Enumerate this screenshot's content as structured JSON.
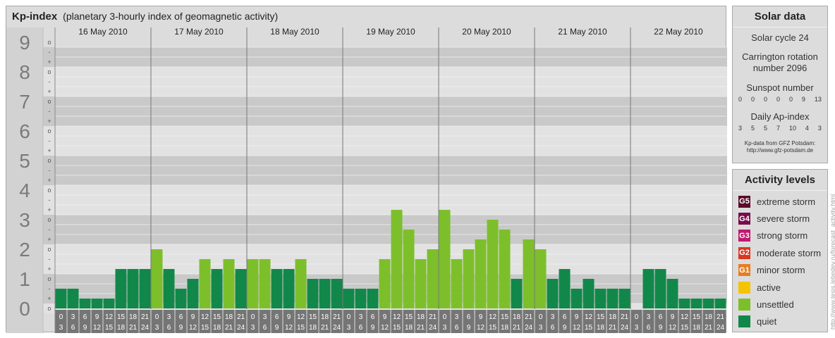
{
  "header": {
    "title": "Kp-index",
    "subtitle": "(planetary 3-hourly index of geomagnetic activity)"
  },
  "chart_data": {
    "type": "bar",
    "title": "Kp-index",
    "subtitle": "(planetary 3-hourly index of geomagnetic activity)",
    "y_ticks": [
      "0",
      "1",
      "2",
      "3",
      "4",
      "5",
      "6",
      "7",
      "8",
      "9"
    ],
    "y_subticks": [
      "o",
      "+",
      "-"
    ],
    "ylim": [
      0,
      9
    ],
    "x_dates": [
      "16 May 2010",
      "17 May 2010",
      "18 May 2010",
      "19 May 2010",
      "20 May 2010",
      "21 May 2010",
      "22 May 2010"
    ],
    "x_time_start": [
      "0",
      "3",
      "6",
      "9",
      "12",
      "15",
      "18",
      "21"
    ],
    "x_time_end": [
      "3",
      "6",
      "9",
      "12",
      "15",
      "18",
      "21",
      "24"
    ],
    "values": [
      [
        0.667,
        0.667,
        0.333,
        0.333,
        0.333,
        1.333,
        1.333,
        1.333
      ],
      [
        2.0,
        1.333,
        0.667,
        1.0,
        1.667,
        1.333,
        1.667,
        1.333
      ],
      [
        1.667,
        1.667,
        1.333,
        1.333,
        1.667,
        1.0,
        1.0,
        1.0
      ],
      [
        0.667,
        0.667,
        0.667,
        1.667,
        3.333,
        2.667,
        1.667,
        2.0
      ],
      [
        3.333,
        1.667,
        2.0,
        2.333,
        3.0,
        2.667,
        1.0,
        2.333
      ],
      [
        2.0,
        1.0,
        1.333,
        0.667,
        1.0,
        0.667,
        0.667,
        0.667
      ],
      [
        0.0,
        1.333,
        1.333,
        1.0,
        0.333,
        0.333,
        0.333,
        0.333
      ]
    ],
    "grid": true,
    "legend": "right"
  },
  "solar": {
    "title": "Solar data",
    "cycle": "Solar cycle 24",
    "carrington_line1": "Carrington rotation",
    "carrington_line2": "number 2096",
    "sunspot_label": "Sunspot number",
    "sunspot_values": [
      "0",
      "0",
      "0",
      "0",
      "0",
      "9",
      "13"
    ],
    "ap_label": "Daily Ap-index",
    "ap_values": [
      "3",
      "5",
      "5",
      "7",
      "10",
      "4",
      "3"
    ],
    "credit_line1": "Kp-data from GFZ Potsdam:",
    "credit_line2": "http://www.gfz-potsdam.de"
  },
  "levels": {
    "title": "Activity levels",
    "items": [
      {
        "code": "G5",
        "label": "extreme storm",
        "color": "#5a0a2a"
      },
      {
        "code": "G4",
        "label": "severe storm",
        "color": "#7a0a4a"
      },
      {
        "code": "G3",
        "label": "strong storm",
        "color": "#c2186e"
      },
      {
        "code": "G2",
        "label": "moderate storm",
        "color": "#d9381e"
      },
      {
        "code": "G1",
        "label": "minor storm",
        "color": "#e67e22"
      },
      {
        "code": "",
        "label": "active",
        "color": "#f5c400"
      },
      {
        "code": "",
        "label": "unsettled",
        "color": "#7dbf2a"
      },
      {
        "code": "",
        "label": "quiet",
        "color": "#11884a"
      }
    ]
  },
  "colors": {
    "quiet": "#11884a",
    "unsettled": "#7dbf2a",
    "active": "#f5c400",
    "band_dark": "#c9c9c9",
    "band_light": "#e2e2e2",
    "axis_label_bg": "#757575"
  },
  "watermark": "http://www.tesis.lebedev.ru/forecast_activity.html"
}
